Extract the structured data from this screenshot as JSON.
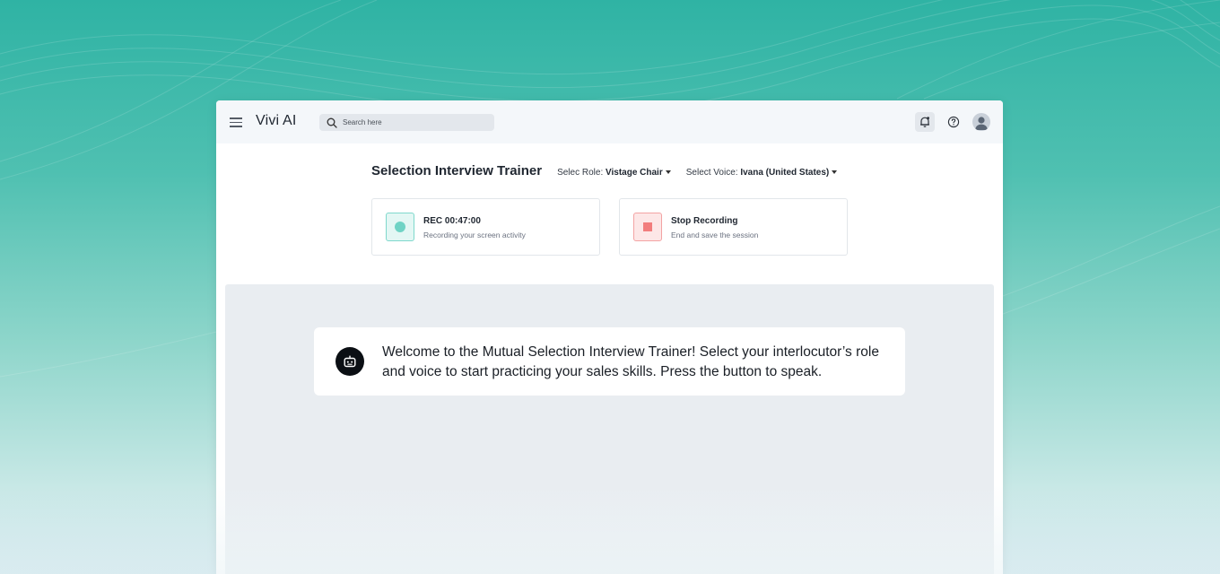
{
  "app": {
    "title": "Vivi AI"
  },
  "search": {
    "placeholder": "Search here"
  },
  "topbar": {
    "icons": [
      "menu-icon",
      "search-icon",
      "bell-icon",
      "help-icon",
      "user-icon"
    ]
  },
  "page": {
    "title": "Selection Interview Trainer",
    "role_label": "Selec Role:",
    "role_value": "Vistage Chair",
    "voice_label": "Select Voice:",
    "voice_value": "Ivana (United States)"
  },
  "cards": {
    "rec": {
      "title": "REC 00:47:00",
      "subtitle": "Recording your screen activity"
    },
    "stop": {
      "title": "Stop Recording",
      "subtitle": "End and save the session"
    }
  },
  "chat": {
    "message": "Welcome to the Mutual Selection Interview Trainer! Select your interlocutor’s role and voice to start practicing your sales skills. Press the button to speak."
  },
  "colors": {
    "background_teal": "#2fb3a4",
    "rec_accent": "#6fd3c5",
    "stop_accent": "#f27d7d"
  }
}
